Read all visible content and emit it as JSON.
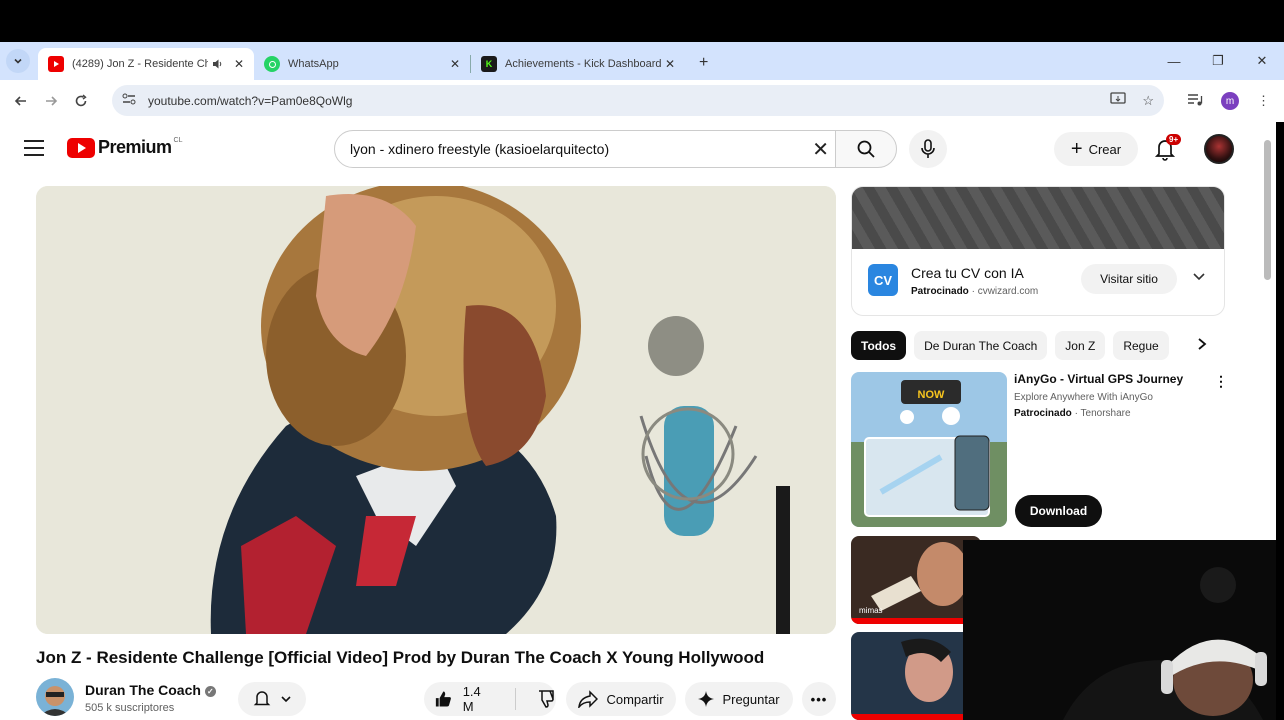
{
  "browser": {
    "tabs": [
      {
        "title": "(4289) Jon Z - Residente Ch",
        "active": true
      },
      {
        "title": "WhatsApp",
        "active": false
      },
      {
        "title": "Achievements - Kick Dashboard",
        "active": false
      }
    ],
    "url": "youtube.com/watch?v=Pam0e8QoWlg"
  },
  "youtube": {
    "logo_text": "Premium",
    "country_code": "CL",
    "search_query": "lyon - xdinero freestyle (kasioelarquitecto)",
    "create_label": "Crear",
    "notif_badge": "9+"
  },
  "video": {
    "title": "Jon Z - Residente Challenge [Official Video] Prod by Duran The Coach X Young Hollywood",
    "channel": "Duran The Coach",
    "subscribers": "505 k suscriptores",
    "likes": "1.4 M",
    "share_label": "Compartir",
    "ask_label": "Preguntar"
  },
  "sidebar": {
    "ad": {
      "logo": "CV",
      "title": "Crea tu CV con IA",
      "sponsored": "Patrocinado",
      "domain": "cvwizard.com",
      "button": "Visitar sitio"
    },
    "chips": [
      "Todos",
      "De Duran The Coach",
      "Jon Z",
      "Regue"
    ],
    "promo": {
      "title": "iAnyGo - Virtual GPS Journey",
      "subtitle": "Explore Anywhere With iAnyGo",
      "sponsored": "Patrocinado",
      "advertiser": "Tenorshare",
      "button": "Download",
      "thumb_text": "NOW"
    },
    "rec2_label": "mimas"
  },
  "colors": {
    "yt_red": "#ff0000",
    "tabstrip": "#d3e3fd",
    "chip_active": "#0f0f0f"
  }
}
